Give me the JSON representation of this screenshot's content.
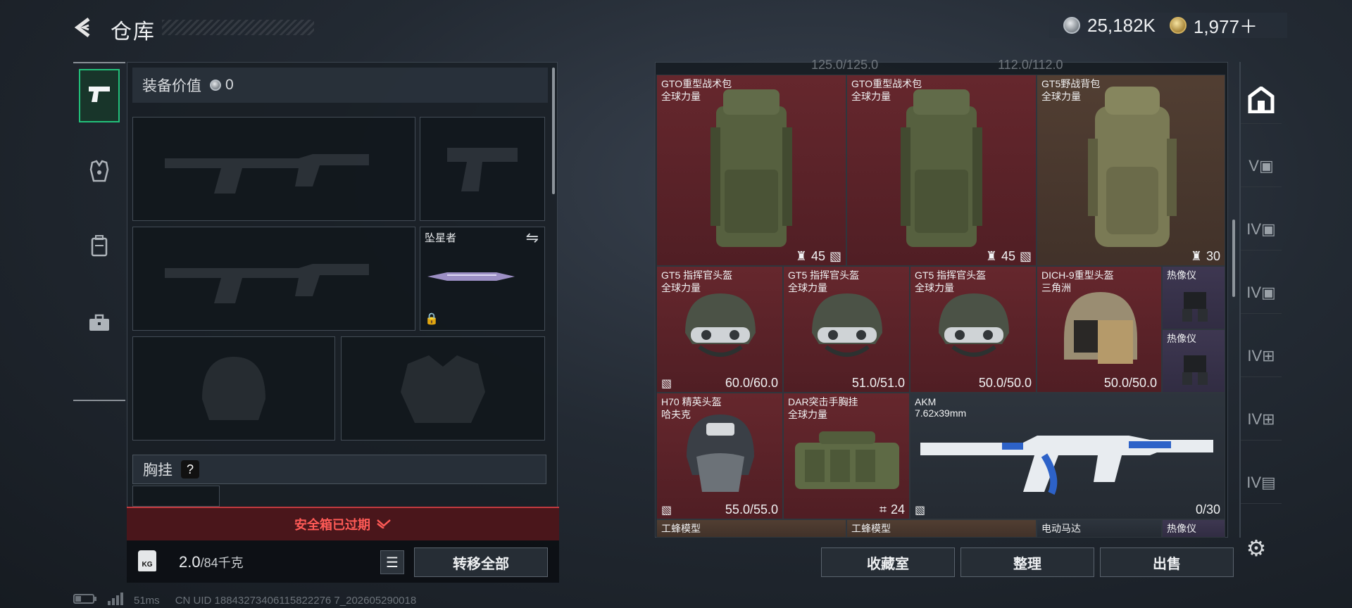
{
  "header": {
    "title": "仓库",
    "silver_amount": "25,182K",
    "gold_amount": "1,977＋"
  },
  "equipment": {
    "value_label": "装备价值",
    "value": "0",
    "melee_name": "坠星者",
    "rig_label": "胸挂",
    "help": "?"
  },
  "secure_case": {
    "text": "安全箱已过期"
  },
  "weight": {
    "current": "2.0",
    "capacity": "/84千克"
  },
  "buttons": {
    "transfer_all": "转移全部",
    "collection": "收藏室",
    "organize": "整理",
    "sell": "出售"
  },
  "status": {
    "ping": "51ms",
    "uid": "CN UID 18843273406115822276 7_202605290018"
  },
  "storage": {
    "top_row_text": "125.0/125.0                                  112.0/112.0",
    "items": [
      {
        "name": "GTO重型战术包",
        "sub": "全球力量",
        "stat": "45"
      },
      {
        "name": "GTO重型战术包",
        "sub": "全球力量",
        "stat": "45"
      },
      {
        "name": "GT5野战背包",
        "sub": "全球力量",
        "stat": "30"
      },
      {
        "name": "GT5 指挥官头盔",
        "sub": "全球力量",
        "stat": "60.0/60.0"
      },
      {
        "name": "GT5 指挥官头盔",
        "sub": "全球力量",
        "stat": "51.0/51.0"
      },
      {
        "name": "GT5 指挥官头盔",
        "sub": "全球力量",
        "stat": "50.0/50.0"
      },
      {
        "name": "DICH-9重型头盔",
        "sub": "三角洲",
        "stat": "50.0/50.0"
      },
      {
        "name": "热像仪",
        "sub": "",
        "stat": ""
      },
      {
        "name": "热像仪",
        "sub": "",
        "stat": ""
      },
      {
        "name": "H70 精英头盔",
        "sub": "哈夫克",
        "stat": "55.0/55.0"
      },
      {
        "name": "DAR突击手胸挂",
        "sub": "全球力量",
        "stat": "24"
      },
      {
        "name": "AKM",
        "sub": "7.62x39mm",
        "stat": "0/30"
      }
    ],
    "bottom_row": [
      "工蜂模型",
      "工蜂模型",
      "电动马达",
      "热像仪"
    ]
  },
  "icons": {
    "back": "back-arrow-icon",
    "silver": "silver-coin-icon",
    "gold": "gold-coin-icon",
    "tabs": [
      "pistol-icon",
      "armor-icon",
      "backpack-icon",
      "briefcase-icon"
    ],
    "right_tabs": [
      "home-icon",
      "storage-v-icon",
      "storage-iv-icon",
      "storage-iv-icon",
      "storage-iv-add-icon",
      "storage-iv-add-icon",
      "storage-iv-icon"
    ],
    "settings": "gear-icon"
  },
  "colors": {
    "active_tab": "#22c07a",
    "expired": "#ff5a56",
    "red_rarity": "#6e282e",
    "gold_rarity": "#584234",
    "purple_rarity": "#423a56"
  }
}
